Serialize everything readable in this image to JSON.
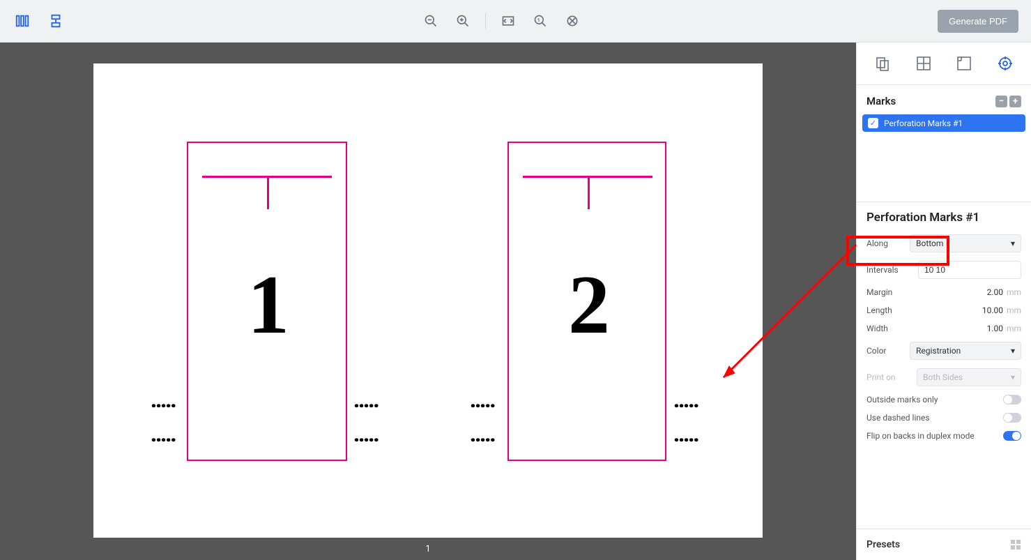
{
  "toolbar": {
    "generate_pdf": "Generate PDF"
  },
  "canvas": {
    "page_number_label": "1",
    "pages": {
      "p1": "1",
      "p2": "2"
    }
  },
  "sidebar": {
    "marks_header": "Marks",
    "mark_item": "Perforation Marks #1",
    "properties_title": "Perforation Marks #1",
    "along_label": "Along",
    "along_value": "Bottom",
    "intervals_label": "Intervals",
    "intervals_value": "10 10",
    "margin_label": "Margin",
    "margin_value": "2.00",
    "margin_unit": "mm",
    "length_label": "Length",
    "length_value": "10.00",
    "length_unit": "mm",
    "width_label": "Width",
    "width_value": "1.00",
    "width_unit": "mm",
    "color_label": "Color",
    "color_value": "Registration",
    "print_on_label": "Print on",
    "print_on_value": "Both Sides",
    "outside_label": "Outside marks only",
    "dashed_label": "Use dashed lines",
    "flip_label": "Flip on backs in duplex mode",
    "presets_label": "Presets"
  }
}
